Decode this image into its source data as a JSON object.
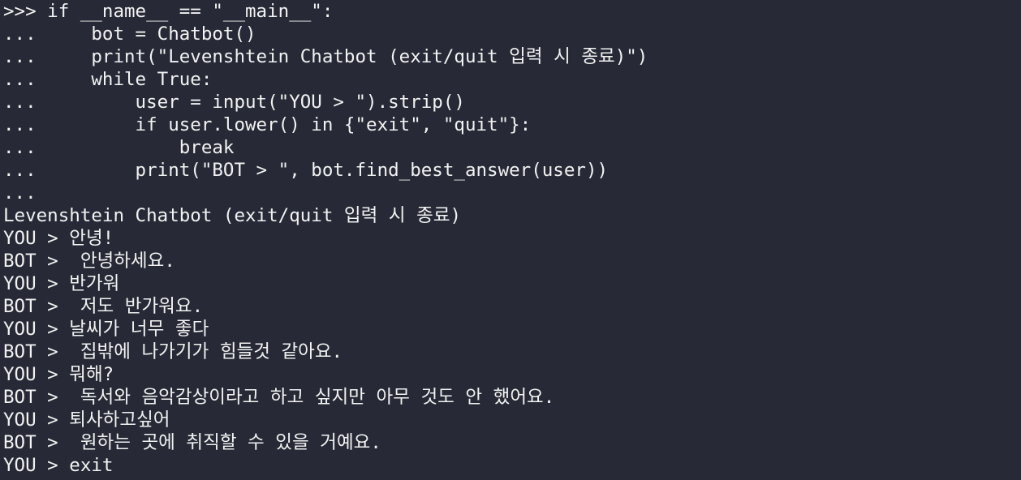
{
  "terminal": {
    "background": "#272a36",
    "foreground": "#f2f2f2",
    "lines": [
      ">>> if __name__ == \"__main__\":",
      "...     bot = Chatbot()",
      "...     print(\"Levenshtein Chatbot (exit/quit 입력 시 종료)\")",
      "...     while True:",
      "...         user = input(\"YOU > \").strip()",
      "...         if user.lower() in {\"exit\", \"quit\"}:",
      "...             break",
      "...         print(\"BOT > \", bot.find_best_answer(user))",
      "...",
      "Levenshtein Chatbot (exit/quit 입력 시 종료)",
      "YOU > 안녕!",
      "BOT >  안녕하세요.",
      "YOU > 반가워",
      "BOT >  저도 반가워요.",
      "YOU > 날씨가 너무 좋다",
      "BOT >  집밖에 나가기가 힘들것 같아요.",
      "YOU > 뭐해?",
      "BOT >  독서와 음악감상이라고 하고 싶지만 아무 것도 안 했어요.",
      "YOU > 퇴사하고싶어",
      "BOT >  원하는 곳에 취직할 수 있을 거예요.",
      "YOU > exit"
    ]
  }
}
